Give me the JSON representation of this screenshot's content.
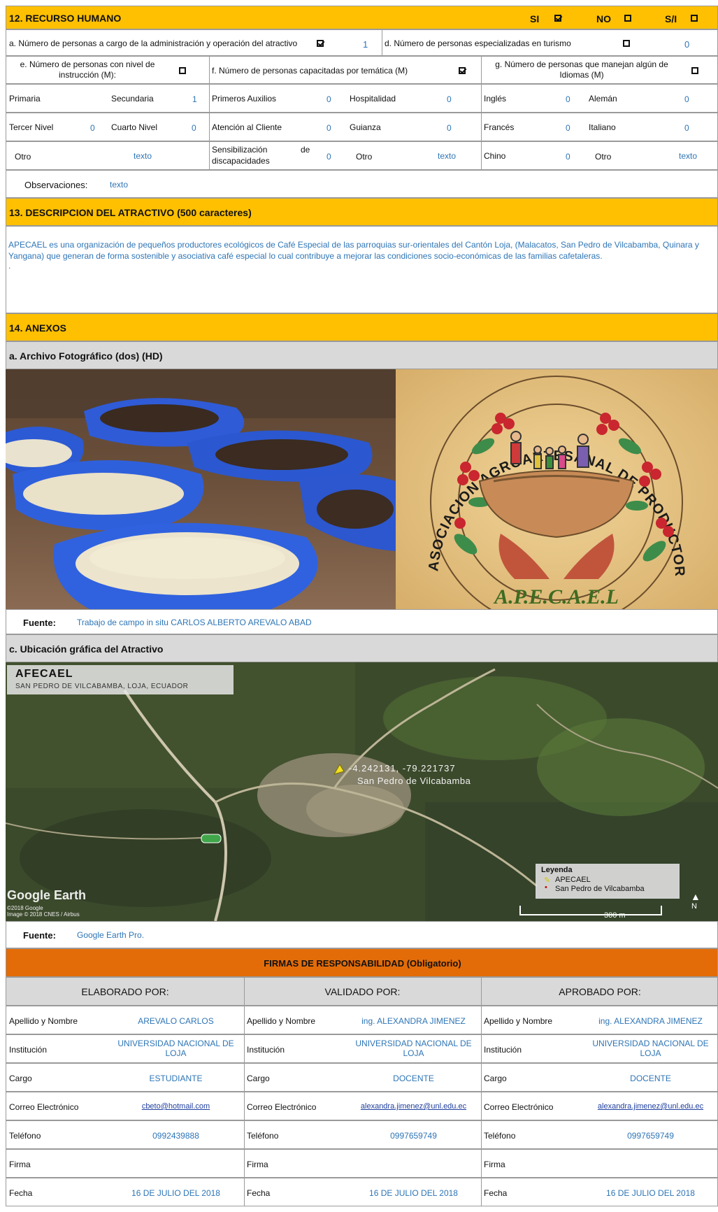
{
  "s12": {
    "title": "12. RECURSO HUMANO",
    "si": "SI",
    "no": "NO",
    "si_no": "S/I",
    "a_label": "a. Número de personas a cargo de la administración y operación del atractivo",
    "a_value": "1",
    "d_label": "d. Número de personas especializadas en turismo",
    "d_value": "0",
    "e_label": "e. Número de personas con nivel de instrucción (M):",
    "f_label": "f. Número de personas capacitadas por temática (M)",
    "g_label": "g. Número de personas que manejan algún de Idiomas (M)",
    "primaria": "Primaria",
    "secundaria": "Secundaria",
    "secundaria_v": "1",
    "primeros": "Primeros Auxilios",
    "primeros_v": "0",
    "hospitalidad": "Hospitalidad",
    "hospitalidad_v": "0",
    "ingles": "Inglés",
    "ingles_v": "0",
    "aleman": "Alemán",
    "aleman_v": "0",
    "tercer": "Tercer Nivel",
    "tercer_v": "0",
    "cuarto": "Cuarto Nivel",
    "cuarto_v": "0",
    "atencion": "Atención al Cliente",
    "atencion_v": "0",
    "guianza": "Guianza",
    "guianza_v": "0",
    "frances": "Francés",
    "frances_v": "0",
    "italiano": "Italiano",
    "italiano_v": "0",
    "otro": "Otro",
    "otro_v": "texto",
    "sensib_1": "Sensibilización",
    "sensib_de": "de",
    "sensib_2": "discapacidades",
    "sensib_v": "0",
    "otro2": "Otro",
    "otro2_v": "texto",
    "chino": "Chino",
    "chino_v": "0",
    "otro3": "Otro",
    "otro3_v": "texto",
    "obs_label": "Observaciones:",
    "obs_value": "texto"
  },
  "s13": {
    "title": "13. DESCRIPCION DEL ATRACTIVO (500 caracteres)",
    "line1": "APECAEL es una organización de pequeños productores ecológicos de Café Especial de las parroquias sur-orientales del Cantón Loja, (Malacatos, San Pedro de Vilcabamba, Quinara y",
    "line2": "Yangana) que generan de forma sostenible y asociativa café especial lo cual contribuye a mejorar las condiciones socio-económicas de las familias cafetaleras.",
    "line3": "."
  },
  "s14": {
    "title": "14. ANEXOS",
    "a_title": "a. Archivo Fotográfico (dos) (HD)",
    "logo_ring": "ASOCIACION AGROARTESANAL DE PRODUCTORES ECOLOGICOS DE CAFE ESPECIAL DEL CANTÓN LOJA",
    "logo_name": "A.P.E.C.A.E.L",
    "fuente_label": "Fuente:",
    "fuente_a": "Trabajo de campo in situ CARLOS ALBERTO AREVALO ABAD",
    "c_title": "c. Ubicación gráfica del Atractivo",
    "map_title": "AFECAEL",
    "map_subtitle": "SAN PEDRO DE VILCABAMBA, LOJA, ECUADOR",
    "map_coords": "-4.242131, -79.221737",
    "map_place": "San Pedro de Vilcabamba",
    "legend_title": "Leyenda",
    "legend_1": "APECAEL",
    "legend_2": "San Pedro de Vilcabamba",
    "scale": "300 m",
    "google": "Google Earth",
    "copy1": "©2018 Google",
    "copy2": "Image © 2018 CNES / Airbus",
    "north": "N",
    "fuente_c": "Google Earth Pro."
  },
  "firmas": {
    "title": "FIRMAS DE RESPONSABILIDAD (Obligatorio)",
    "cols": [
      "ELABORADO POR:",
      "VALIDADO  POR:",
      "APROBADO POR:"
    ],
    "labels": [
      "Apellido y Nombre",
      "Institución",
      "Cargo",
      "Correo Electrónico",
      "Teléfono",
      "Firma",
      "Fecha"
    ],
    "col1": [
      "AREVALO CARLOS",
      "UNIVERSIDAD NACIONAL DE LOJA",
      "ESTUDIANTE",
      "cbeto@hotmail.com",
      "0992439888",
      "",
      "16 DE JULIO DEL 2018"
    ],
    "col2": [
      "ing. ALEXANDRA JIMENEZ",
      "UNIVERSIDAD NACIONAL DE LOJA",
      "DOCENTE",
      "alexandra.jimenez@unl.edu.ec",
      "0997659749",
      "",
      "16 DE JULIO DEL 2018"
    ],
    "col3": [
      "ing. ALEXANDRA JIMENEZ",
      "UNIVERSIDAD NACIONAL DE LOJA",
      "DOCENTE",
      "alexandra.jimenez@unl.edu.ec",
      "0997659749",
      "",
      "16 DE JULIO DEL 2018"
    ]
  },
  "colors": {
    "yellow": "#fec000",
    "orange": "#e36c09",
    "gray": "#d9d9d9",
    "blue_text": "#2e75b6"
  }
}
